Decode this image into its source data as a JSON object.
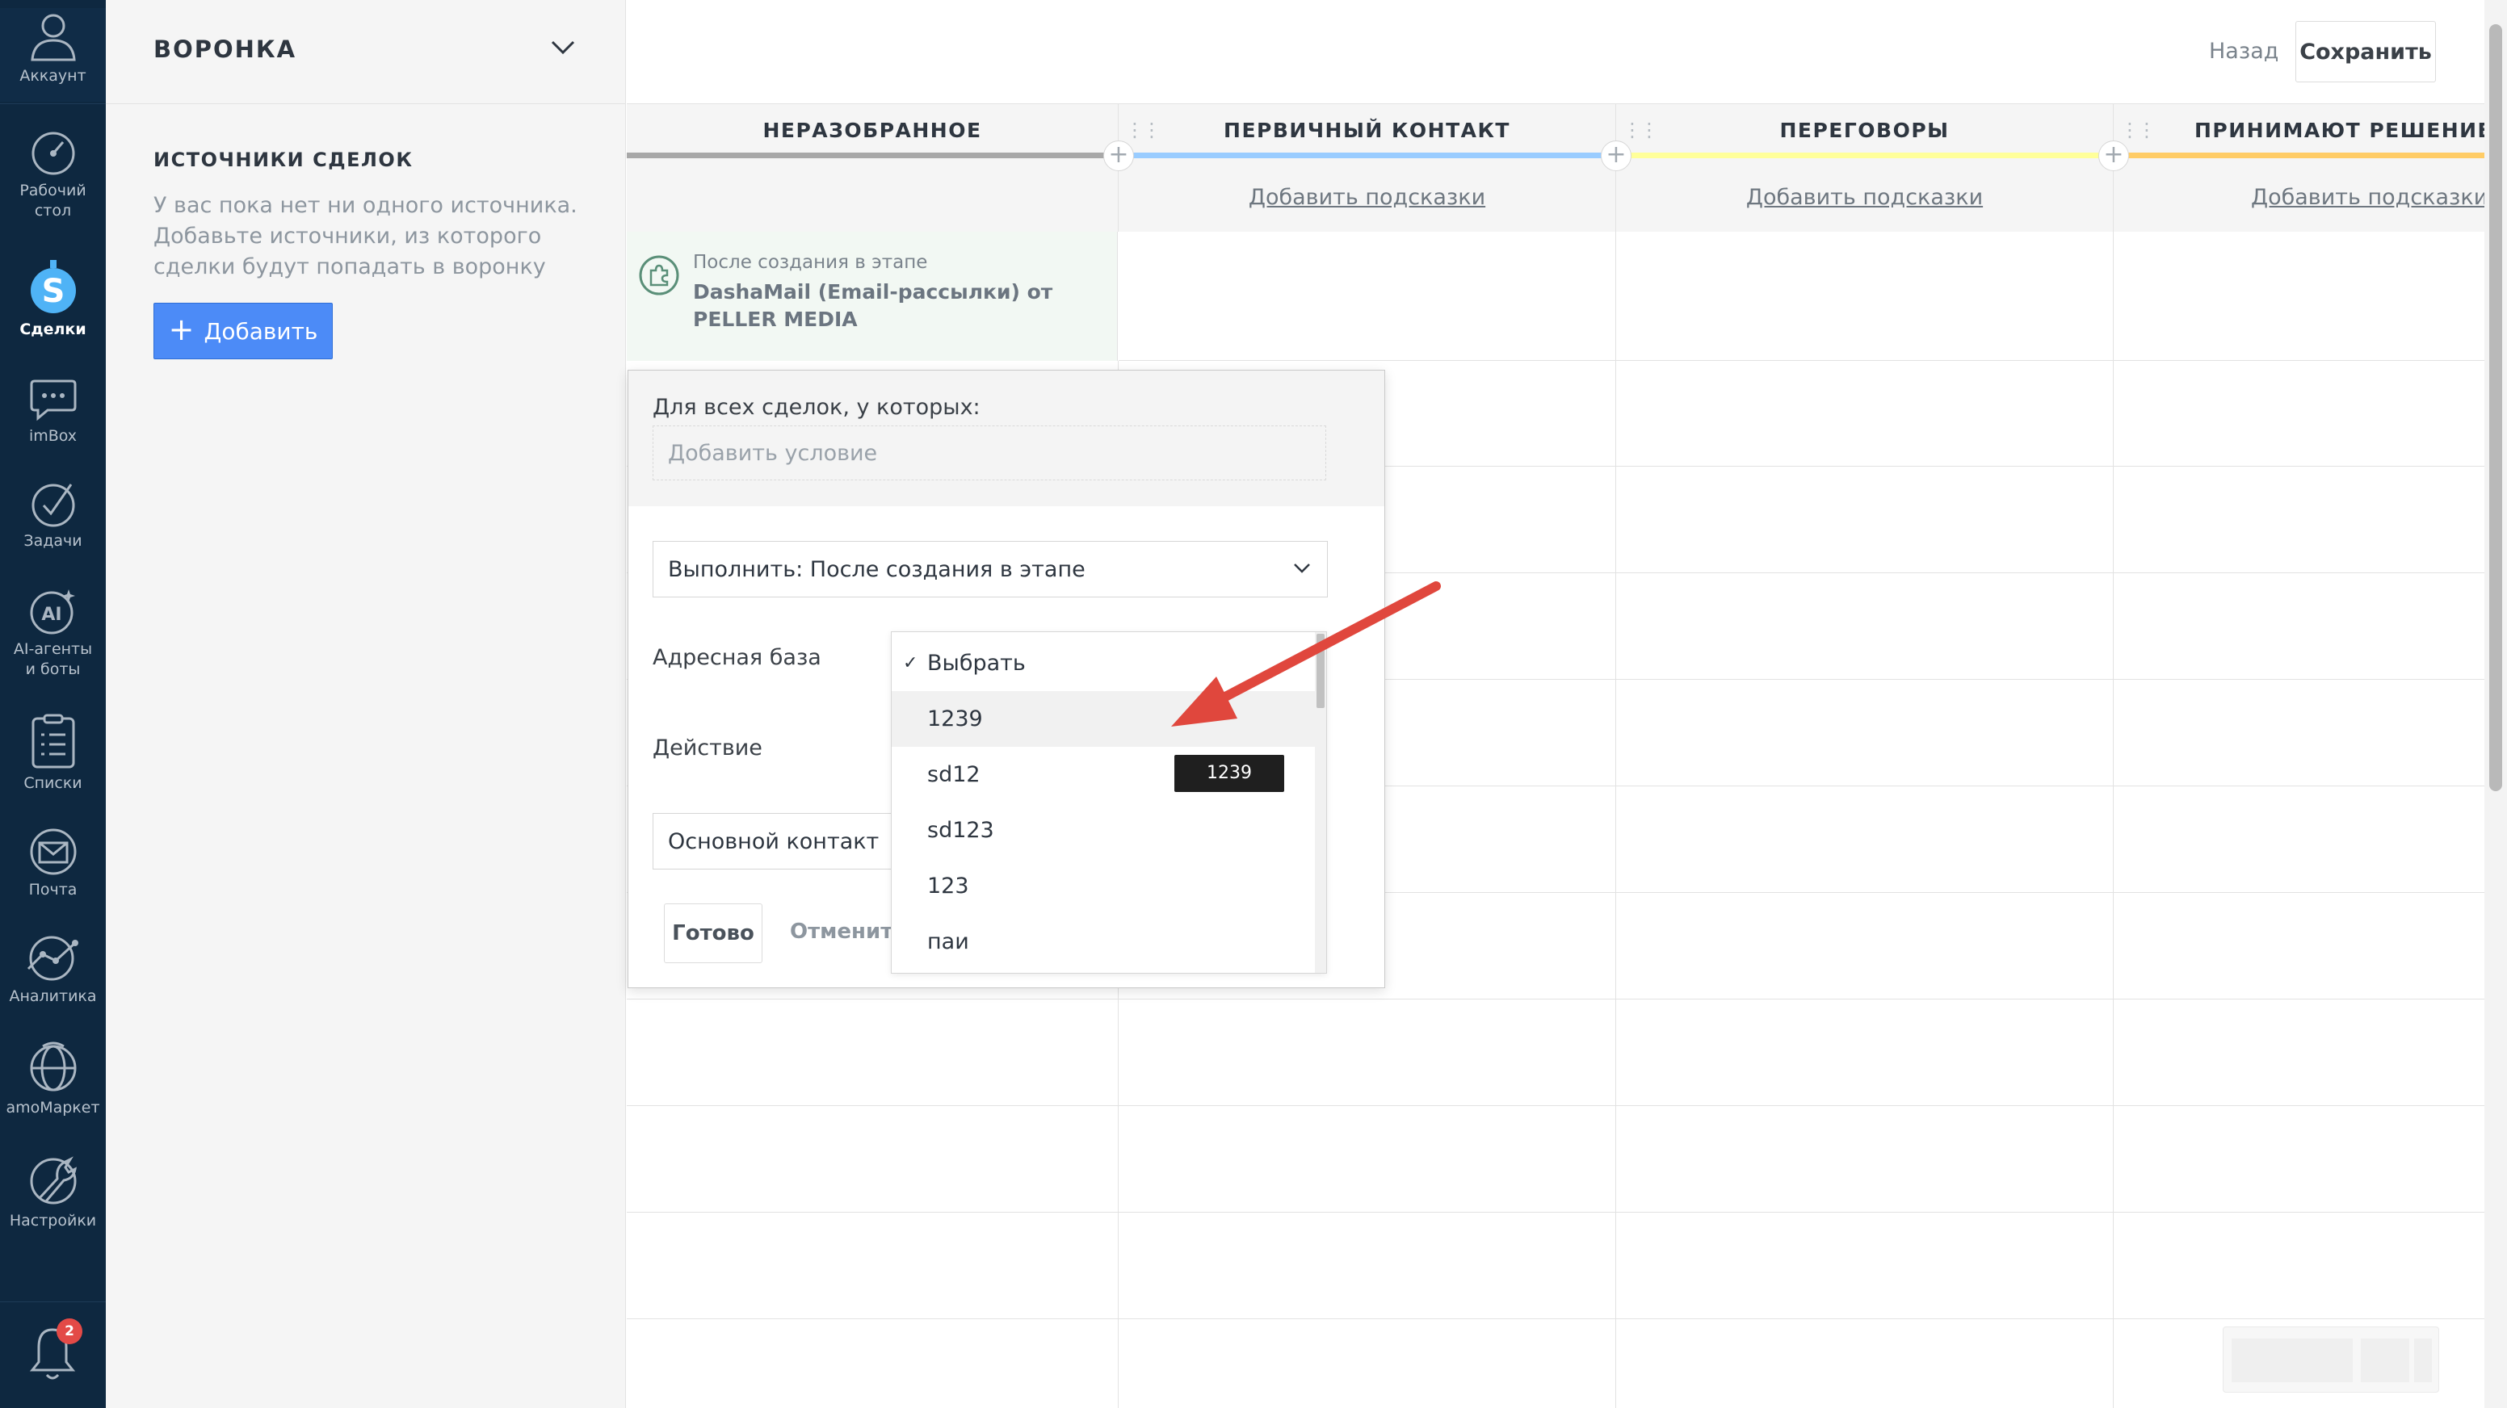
{
  "nav": {
    "account": "Аккаунт",
    "items": [
      {
        "icon": "dashboard-icon",
        "label_1": "Рабочий",
        "label_2": "стол"
      },
      {
        "icon": "deals-icon",
        "label_1": "Сделки",
        "label_2": ""
      },
      {
        "icon": "chat-icon",
        "label_1": "imBox",
        "label_2": ""
      },
      {
        "icon": "tasks-icon",
        "label_1": "Задачи",
        "label_2": ""
      },
      {
        "icon": "ai-icon",
        "label_1": "AI-агенты",
        "label_2": "и боты"
      },
      {
        "icon": "lists-icon",
        "label_1": "Списки",
        "label_2": ""
      },
      {
        "icon": "mail-icon",
        "label_1": "Почта",
        "label_2": ""
      },
      {
        "icon": "analytics-icon",
        "label_1": "Аналитика",
        "label_2": ""
      },
      {
        "icon": "market-icon",
        "label_1": "amoМаркет",
        "label_2": ""
      },
      {
        "icon": "settings-icon",
        "label_1": "Настройки",
        "label_2": ""
      }
    ],
    "active": "Сделки",
    "notifications_count": "2"
  },
  "sidebar": {
    "funnel_title": "ВОРОНКА",
    "sources_title": "ИСТОЧНИКИ СДЕЛОК",
    "sources_text": "У вас пока нет ни одного источника. Добавьте источники, из которого сделки будут попадать в воронку",
    "add_button": "Добавить",
    "add_icon": "+"
  },
  "topbar": {
    "back": "Назад",
    "save": "Сохранить"
  },
  "board": {
    "columns": [
      {
        "title": "НЕРАЗОБРАННОЕ",
        "color": "#a8a8a8",
        "hint": ""
      },
      {
        "title": "ПЕРВИЧНЫЙ КОНТАКТ",
        "color": "#99ccff",
        "hint": "Добавить подсказки"
      },
      {
        "title": "ПЕРЕГОВОРЫ",
        "color": "#ffff99",
        "hint": "Добавить подсказки"
      },
      {
        "title": "ПРИНИМАЮТ РЕШЕНИЕ",
        "color": "#ffcc66",
        "hint": "Добавить подсказки"
      }
    ],
    "trigger": {
      "label": "После создания в этапе",
      "name": "DashaMail (Email-рассылки) от PELLER MEDIA"
    }
  },
  "popup": {
    "condition_label": "Для всех сделок, у которых:",
    "condition_placeholder": "Добавить условие",
    "execute_value": "Выполнить: После создания в этапе",
    "address_label": "Адресная база",
    "action_label": "Действие",
    "contact_value": "Основной контакт",
    "done": "Готово",
    "cancel": "Отменить",
    "dropdown": {
      "selected": "Выбрать",
      "options": [
        "Выбрать",
        "1239",
        "sd12",
        "sd123",
        "123",
        "паи"
      ],
      "hovered": "1239"
    },
    "tooltip": "1239"
  },
  "colors": {
    "nav_bg": "#0e2840",
    "accent": "#4c8bf7",
    "annotation": "#e0473d",
    "badge": "#e34a47"
  }
}
